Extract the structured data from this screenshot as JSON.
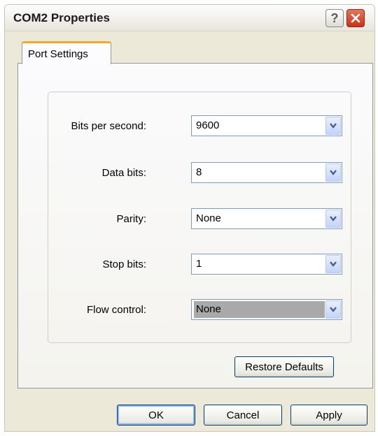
{
  "window": {
    "title": "COM2 Properties"
  },
  "title_buttons": {
    "help_label": "?"
  },
  "tabs": [
    {
      "label": "Port Settings"
    }
  ],
  "settings": [
    {
      "label": "Bits per second:",
      "value": "9600"
    },
    {
      "label": "Data bits:",
      "value": "8"
    },
    {
      "label": "Parity:",
      "value": "None"
    },
    {
      "label": "Stop bits:",
      "value": "1"
    },
    {
      "label": "Flow control:",
      "value": "None"
    }
  ],
  "buttons": {
    "restore_defaults": "Restore Defaults",
    "ok": "OK",
    "cancel": "Cancel",
    "apply": "Apply"
  },
  "icons": {
    "help": "help-icon",
    "close": "close-icon",
    "dropdown": "chevron-down-icon"
  },
  "colors": {
    "window_bg": "#ece9d8",
    "tab_accent": "#f5a623",
    "close_red": "#c8321a",
    "selected_value_bg": "#a9a9a9"
  }
}
